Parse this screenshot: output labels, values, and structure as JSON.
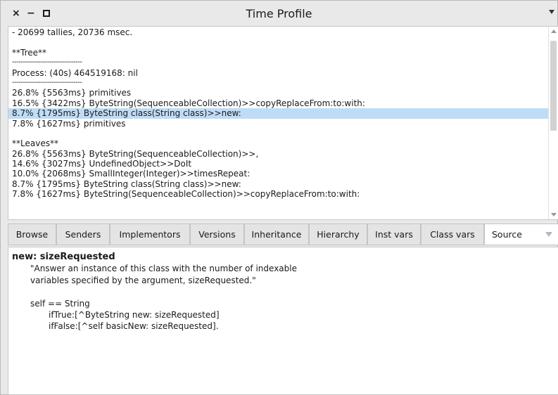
{
  "window": {
    "title": "Time Profile",
    "close_glyph": "×",
    "minimize_glyph": "−"
  },
  "results": {
    "lines": [
      " - 20699 tallies, 20736 msec.",
      "",
      "**Tree**",
      "--------------------------------",
      "Process: (40s)  464519168: nil",
      "--------------------------------",
      "26.8% {5563ms} primitives",
      "16.5% {3422ms} ByteString(SequenceableCollection)>>copyReplaceFrom:to:with:",
      "  8.7% {1795ms} ByteString class(String class)>>new:",
      "  7.8% {1627ms} primitives",
      "",
      "**Leaves**",
      "26.8% {5563ms} ByteString(SequenceableCollection)>>,",
      "14.6% {3027ms} UndefinedObject>>DoIt",
      "10.0% {2068ms} SmallInteger(Integer)>>timesRepeat:",
      "8.7% {1795ms} ByteString class(String class)>>new:",
      "7.8% {1627ms} ByteString(SequenceableCollection)>>copyReplaceFrom:to:with:"
    ],
    "selected_index": 8
  },
  "toolbar": {
    "buttons": [
      "Browse",
      "Senders",
      "Implementors",
      "Versions",
      "Inheritance",
      "Hierarchy",
      "Inst vars",
      "Class vars"
    ],
    "source_label": "Source"
  },
  "source": {
    "header": "new: sizeRequested",
    "comment_1": "\"Answer an instance of this class with the number of indexable",
    "comment_2": "variables specified by the argument, sizeRequested.\"",
    "stmt": "self == String",
    "if_true": "ifTrue:[^ByteString new: sizeRequested]",
    "if_false": "ifFalse:[^self basicNew: sizeRequested]."
  },
  "colors": {
    "selection": "#bfdcf7",
    "chrome": "#e9e9e9",
    "button": "#e4e4e4"
  },
  "icons": [
    "close-icon",
    "minimize-icon",
    "maximize-icon",
    "window-menu-icon",
    "scroll-up-icon",
    "scroll-down-icon",
    "dropdown-arrow-icon"
  ]
}
